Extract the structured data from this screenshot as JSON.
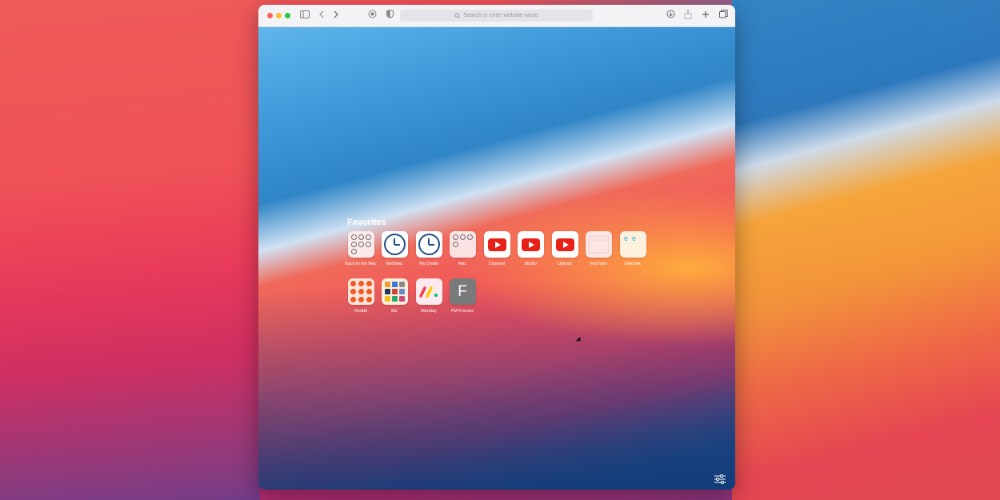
{
  "browser": {
    "search_placeholder": "Search or enter website name"
  },
  "favorites": {
    "title": "Favorites",
    "row1": [
      {
        "label": "Back to the Mac",
        "icon": "clock-grid-icon"
      },
      {
        "label": "9to5Mac",
        "icon": "clock-icon"
      },
      {
        "label": "My Drafts",
        "icon": "clock-icon"
      },
      {
        "label": "Mac",
        "icon": "clock-grid-icon"
      },
      {
        "label": "Channel",
        "icon": "youtube-icon"
      },
      {
        "label": "Studio",
        "icon": "youtube-icon"
      },
      {
        "label": "Upload",
        "icon": "youtube-icon"
      },
      {
        "label": "YouTube",
        "icon": "blank-page-icon"
      },
      {
        "label": "Electrek",
        "icon": "electrek-icon"
      }
    ],
    "row2": [
      {
        "label": "Reddit",
        "icon": "reddit-icon"
      },
      {
        "label": "Biz",
        "icon": "biz-grid-icon"
      },
      {
        "label": "Monday",
        "icon": "monday-icon"
      },
      {
        "label": "FM Forums",
        "icon": "letter-f-icon",
        "letter": "F"
      }
    ]
  },
  "colors": {
    "youtube_red": "#e62117",
    "clock_blue": "#1f4e84",
    "traffic_red": "#fe5f57",
    "traffic_yellow": "#febc2e",
    "traffic_green": "#28c840"
  }
}
